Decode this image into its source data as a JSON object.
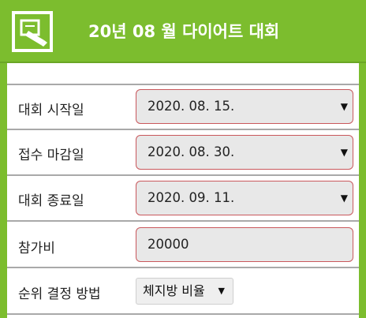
{
  "header": {
    "title": "20년 08 월 다이어트 대회",
    "icon": "note-edit-icon",
    "color": "#7cbd2e"
  },
  "form": {
    "start_date": {
      "label": "대회 시작일",
      "value": "2020. 08. 15."
    },
    "entry_deadline": {
      "label": "접수 마감일",
      "value": "2020. 08. 30."
    },
    "end_date": {
      "label": "대회 종료일",
      "value": "2020. 09. 11."
    },
    "entry_fee": {
      "label": "참가비",
      "value": "20000"
    },
    "ranking_method": {
      "label": "순위 결정 방법",
      "value": "체지방 비율"
    }
  },
  "colors": {
    "field_border": "#c9585c",
    "field_background": "#e8e8e8"
  }
}
